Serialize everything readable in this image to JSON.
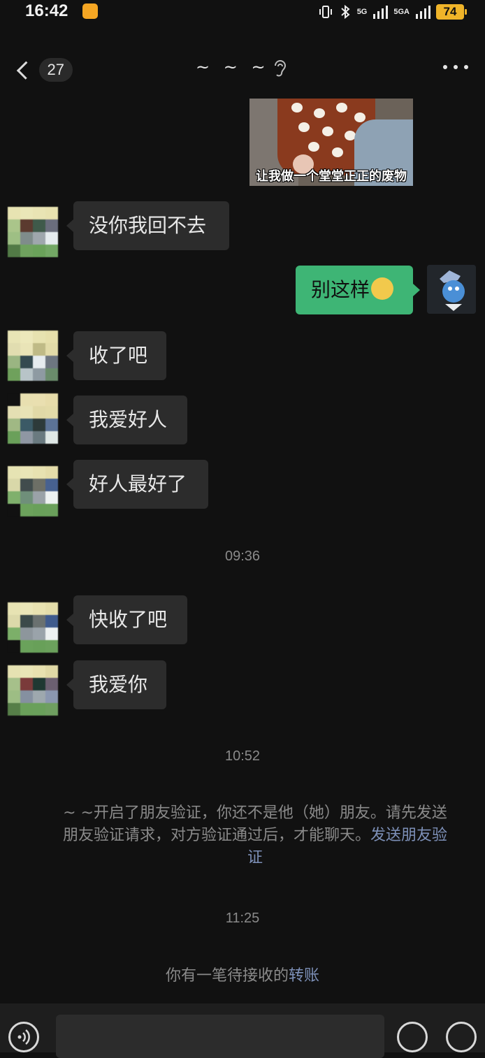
{
  "status_bar": {
    "time": "16:42",
    "network_1": "5G",
    "network_2": "5GA",
    "battery": "74"
  },
  "header": {
    "unread_count": "27",
    "title": "~ ~ ~",
    "icons": [
      "back-chevron-icon",
      "ear-icon",
      "more-icon"
    ]
  },
  "sticker": {
    "caption": "让我做一个堂堂正正的废物"
  },
  "messages": [
    {
      "side": "in",
      "text": "没你我回不去"
    },
    {
      "side": "out",
      "text": "别这样",
      "emoji": "crying-face-emoji"
    },
    {
      "side": "in",
      "text": "收了吧"
    },
    {
      "side": "in",
      "text": "我爱好人"
    },
    {
      "side": "in",
      "text": "好人最好了"
    },
    {
      "side": "in",
      "text": "快收了吧"
    },
    {
      "side": "in",
      "text": "我爱你"
    }
  ],
  "timestamps": [
    "09:36",
    "10:52",
    "11:25"
  ],
  "system": {
    "verification_text": "~ ~开启了朋友验证，你还不是他（她）朋友。请先发送朋友验证请求，对方验证通过后，才能聊天。",
    "verification_link": "发送朋友验证",
    "transfer_text": "你有一笔待接收的",
    "transfer_link": "转账"
  },
  "input_bar": {
    "icons": [
      "voice-icon",
      "emoji-icon",
      "plus-icon"
    ]
  },
  "colors": {
    "background": "#111111",
    "incoming_bubble": "#2c2c2c",
    "outgoing_bubble": "#3eb575",
    "link": "#7d90b8",
    "battery": "#f0b429"
  }
}
